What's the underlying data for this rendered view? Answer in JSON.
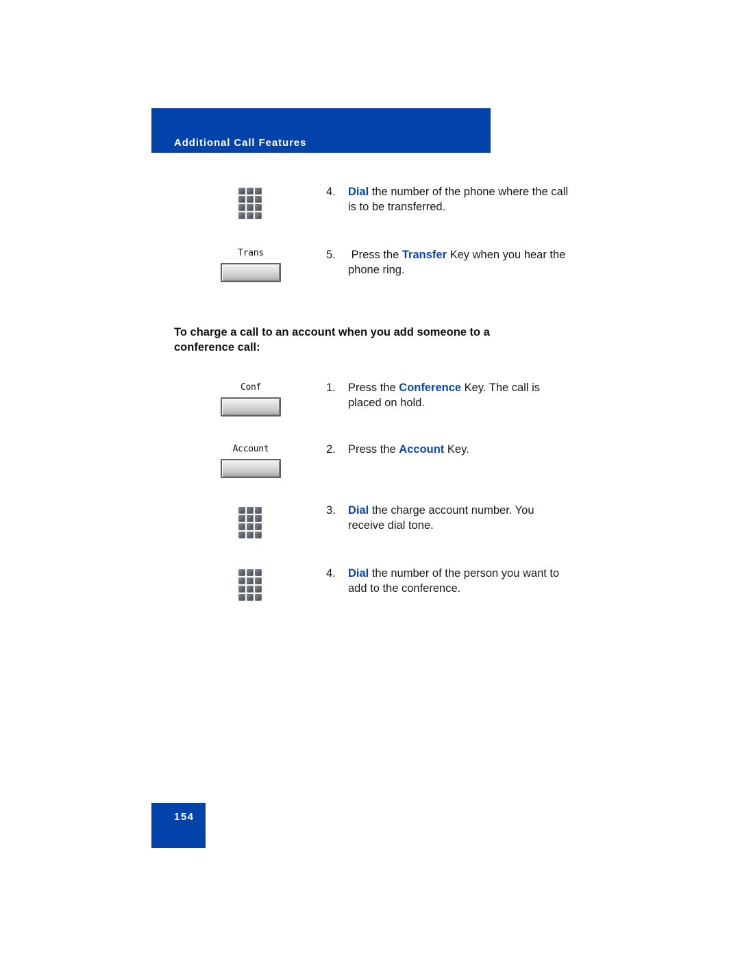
{
  "header": {
    "section_title": "Additional Call Features",
    "accent_color": "#0242ab"
  },
  "transfer_steps": [
    {
      "number": "4.",
      "icon": "keypad-icon",
      "keyword": "Dial",
      "text_before": "",
      "text_after": " the number of the phone where the call is to be transferred."
    },
    {
      "number": "5.",
      "softkey_label": "Trans",
      "keyword": "Transfer",
      "text_before": " Press the ",
      "text_after": " Key when you hear the phone ring."
    }
  ],
  "section": {
    "heading": "To charge a call to an account when you add someone to a conference call:"
  },
  "account_steps": [
    {
      "number": "1.",
      "softkey_label": "Conf",
      "keyword": "Conference",
      "text_before": "Press the ",
      "text_after": " Key. The call is placed on hold."
    },
    {
      "number": "2.",
      "softkey_label": "Account",
      "keyword": "Account",
      "text_before": "Press the ",
      "text_after": " Key."
    },
    {
      "number": "3.",
      "icon": "keypad-icon",
      "keyword": "Dial",
      "text_before": "",
      "text_after": " the charge account number. You receive dial tone."
    },
    {
      "number": "4.",
      "icon": "keypad-icon",
      "keyword": "Dial",
      "text_before": "",
      "text_after": " the number of the person you want to add to the conference."
    }
  ],
  "footer": {
    "page_number": "154"
  },
  "colors": {
    "keyword": "#0b45b0",
    "band": "#0242ab"
  }
}
